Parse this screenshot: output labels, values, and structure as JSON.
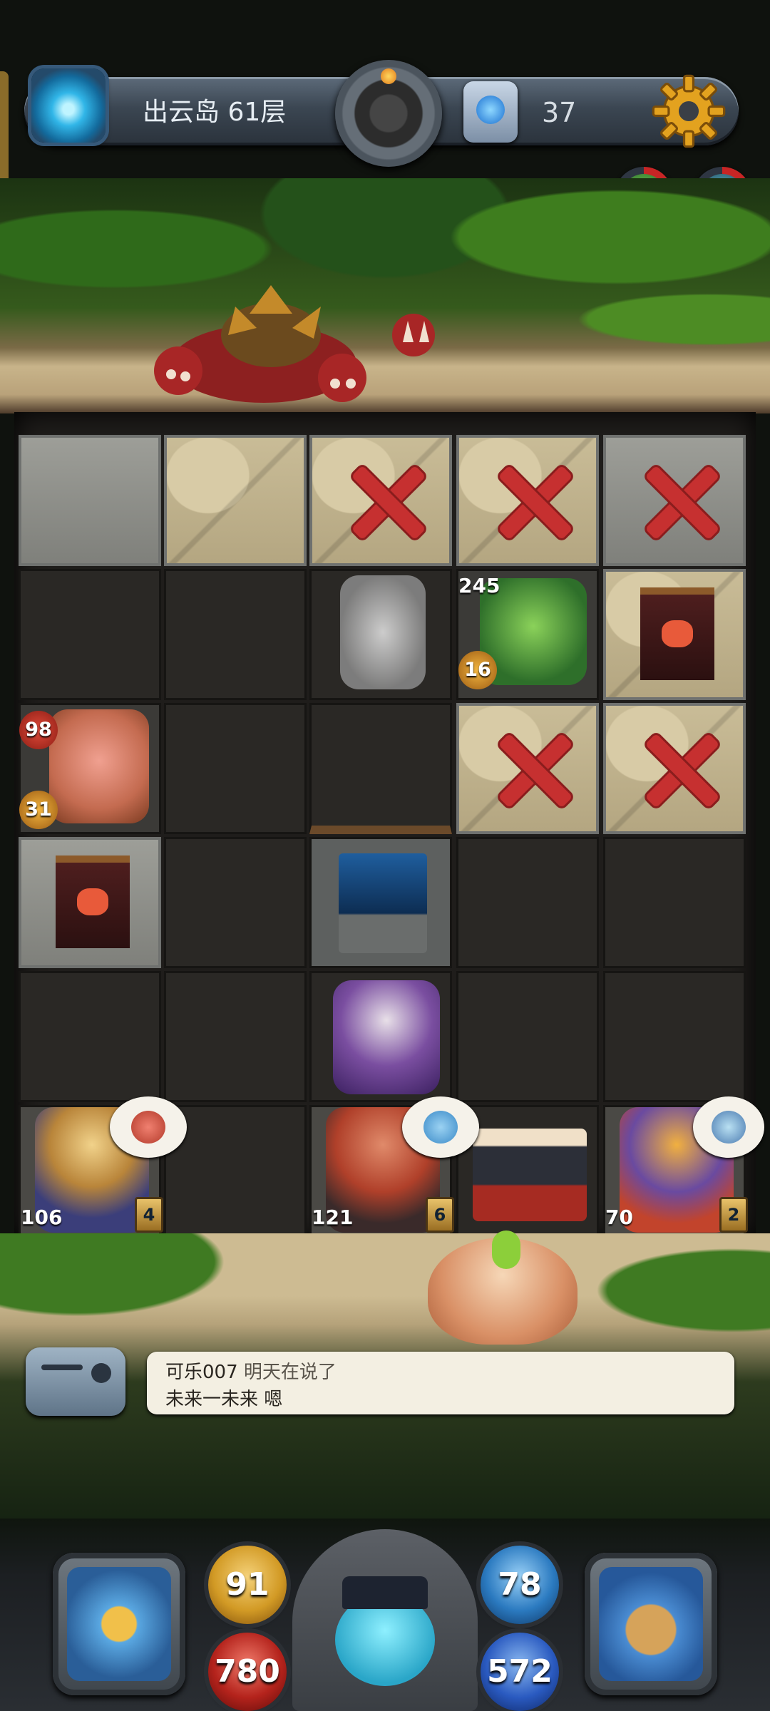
{
  "header": {
    "floor_name": "出云岛 61层",
    "key_count": "37"
  },
  "board": {
    "units": [
      {
        "name": "ghost-merchant",
        "badges": []
      },
      {
        "name": "green-kappa",
        "attack": "245",
        "defense": "16"
      },
      {
        "name": "tongue-lantern",
        "attack": "98",
        "defense": "31"
      },
      {
        "name": "wolf-ninja",
        "attack": "106",
        "level": "4"
      },
      {
        "name": "monkey-warrior",
        "attack": "121",
        "level": "6"
      },
      {
        "name": "crow-tengu",
        "attack": "70",
        "level": "2"
      }
    ]
  },
  "chat": {
    "line1_name": "可乐007",
    "line1_msg": "明天在说了",
    "line2": "未来一未来 嗯"
  },
  "stats": {
    "attack": "91",
    "hp": "780",
    "defense": "78",
    "mp": "572"
  },
  "colors": {
    "cross_red": "#c63030",
    "hp_red": "#b4231c",
    "attack_gold": "#d29a25",
    "defense_blue": "#2b7ac0"
  }
}
